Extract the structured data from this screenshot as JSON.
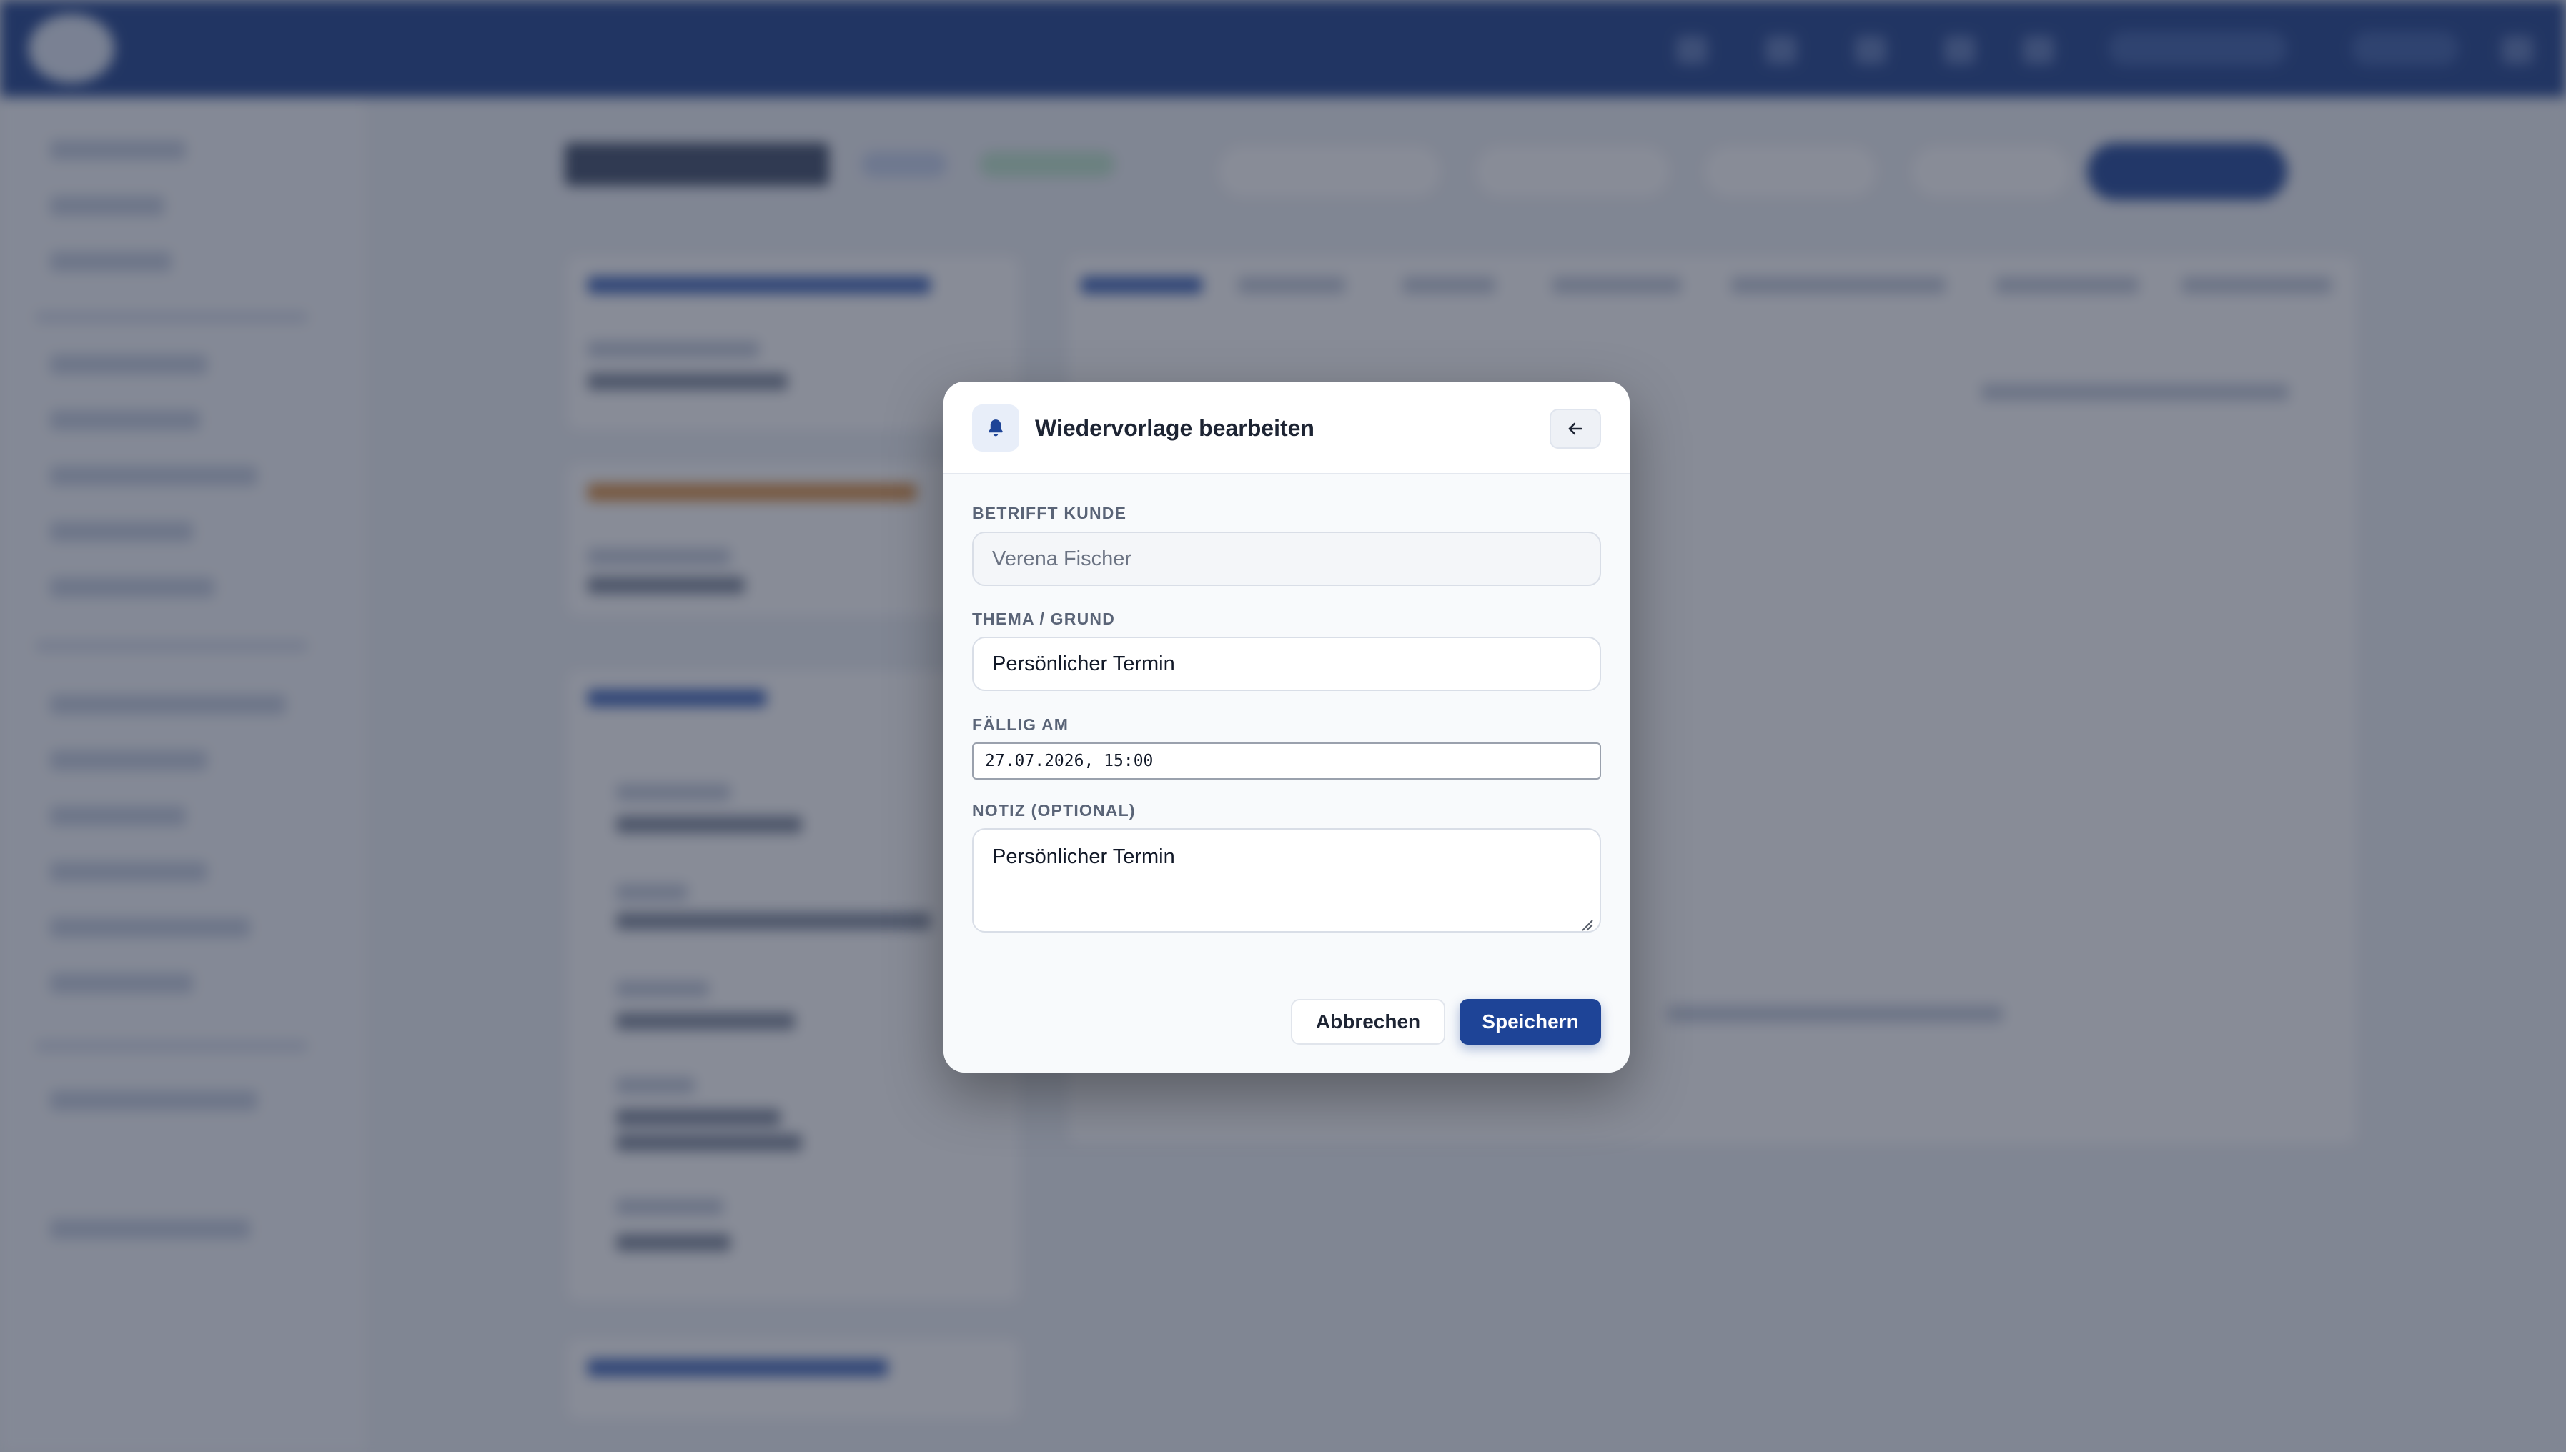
{
  "modal": {
    "title": "Wiedervorlage bearbeiten",
    "icon": "bell-icon",
    "back_icon": "arrow-left-icon",
    "fields": {
      "customer": {
        "label": "BETRIFFT KUNDE",
        "value": "Verena Fischer",
        "disabled": true
      },
      "topic": {
        "label": "THEMA / GRUND",
        "value": "Persönlicher Termin"
      },
      "due": {
        "label": "FÄLLIG AM",
        "value": "27.07.2026, 15:00"
      },
      "note": {
        "label": "NOTIZ (OPTIONAL)",
        "value": "Persönlicher Termin"
      }
    },
    "buttons": {
      "cancel": "Abbrechen",
      "save": "Speichern"
    }
  },
  "colors": {
    "primary": "#1e4497",
    "topbar": "#1c3f8c",
    "overlay": "rgba(38,46,66,0.55)",
    "label": "#5a6477",
    "icon_bg": "#e8eef9"
  }
}
